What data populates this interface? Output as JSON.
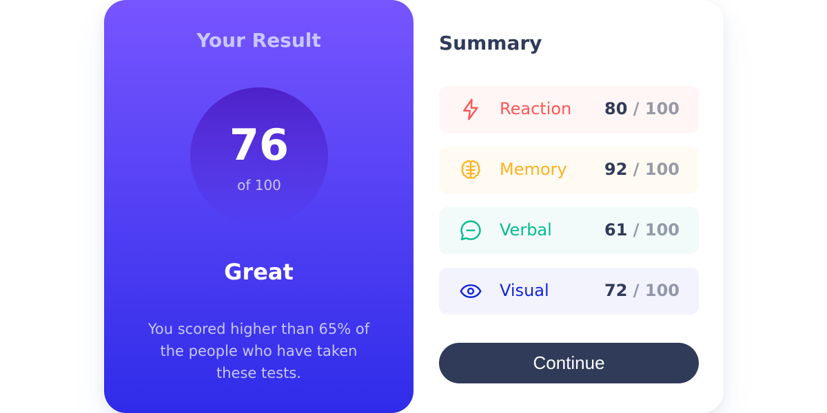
{
  "result": {
    "title": "Your Result",
    "score": "76",
    "of_label": "of 100",
    "rating": "Great",
    "description": "You scored higher than 65% of the people who have taken these tests."
  },
  "summary": {
    "title": "Summary",
    "separator": " / ",
    "items": [
      {
        "label": "Reaction",
        "score": "80",
        "max": "100",
        "icon": "lightning-icon",
        "color": "#FF5757",
        "bg": "#FFF6F5"
      },
      {
        "label": "Memory",
        "score": "92",
        "max": "100",
        "icon": "brain-icon",
        "color": "#FFB01F",
        "bg": "#FFFBF2"
      },
      {
        "label": "Verbal",
        "score": "61",
        "max": "100",
        "icon": "speech-bubble-icon",
        "color": "#00BB8F",
        "bg": "#F2FBFA"
      },
      {
        "label": "Visual",
        "score": "72",
        "max": "100",
        "icon": "eye-icon",
        "color": "#1125D6",
        "bg": "#F3F3FD"
      }
    ]
  },
  "actions": {
    "continue_label": "Continue"
  }
}
